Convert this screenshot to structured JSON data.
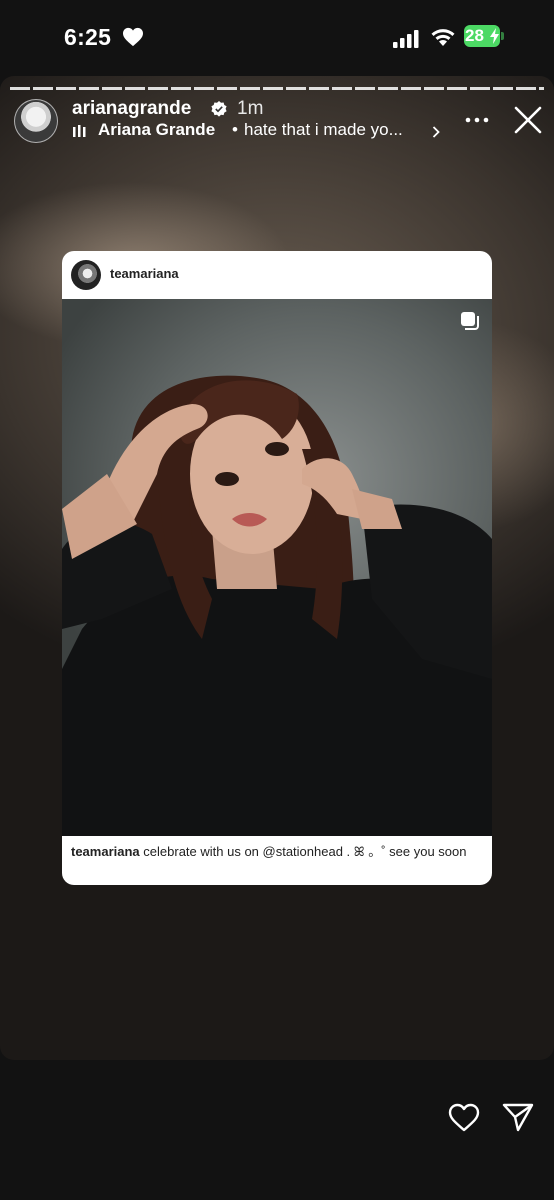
{
  "status_bar": {
    "time": "6:25",
    "battery": "28",
    "battery_color": "#4cd964"
  },
  "story": {
    "username": "arianagrande",
    "time_ago": "1m",
    "music": {
      "artist": "Ariana Grande",
      "separator": "•",
      "song": "hate that i made yo..."
    },
    "icons": [
      "music-bars-icon",
      "chevron-right-icon",
      "more-icon",
      "close-icon",
      "verified-badge-icon"
    ]
  },
  "shared_post": {
    "username": "teamariana",
    "caption_user": "teamariana",
    "caption_text": "celebrate with us on @stationhead . ꕤ 。˚ see you soon"
  },
  "actions": {
    "icons": [
      "heart-icon",
      "send-icon"
    ]
  }
}
